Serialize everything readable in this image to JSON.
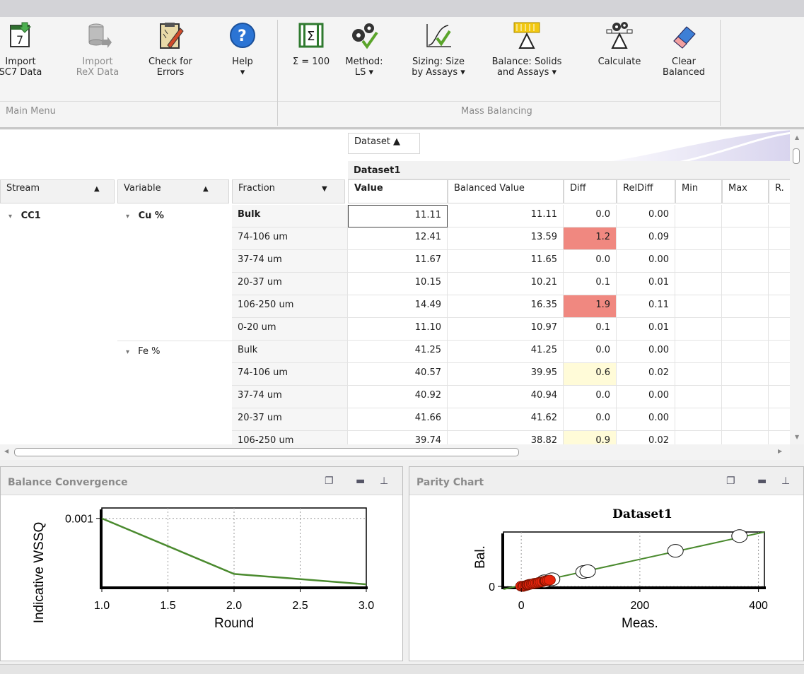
{
  "ribbon": {
    "buttons": [
      {
        "label": "Import\nSC7 Data"
      },
      {
        "label": "Import\nReX Data"
      },
      {
        "label": "Check for\nErrors"
      },
      {
        "label": "Help\n▾"
      },
      {
        "label": "Σ = 100"
      },
      {
        "label": "Method:\nLS ▾"
      },
      {
        "label": "Sizing: Size\nby Assays ▾"
      },
      {
        "label": "Balance: Solids\nand Assays ▾"
      },
      {
        "label": "Calculate"
      },
      {
        "label": "Clear\nBalanced"
      }
    ],
    "groups": {
      "main": "Main Menu",
      "mass": "Mass Balancing"
    }
  },
  "grid": {
    "group_by": "Dataset ▲",
    "dataset": "Dataset1",
    "row_headers": [
      "Stream",
      "Variable",
      "Fraction"
    ],
    "columns": [
      "Value",
      "Balanced Value",
      "Diff",
      "RelDiff",
      "Min",
      "Max",
      "R."
    ],
    "stream": "CC1",
    "variables": [
      "Cu %",
      "Fe %"
    ],
    "rows": [
      {
        "fraction": "Bulk",
        "value": "11.11",
        "balanced": "11.11",
        "diff": "0.0",
        "reldiff": "0.00"
      },
      {
        "fraction": "74-106 um",
        "value": "12.41",
        "balanced": "13.59",
        "diff": "1.2",
        "reldiff": "0.09"
      },
      {
        "fraction": "37-74 um",
        "value": "11.67",
        "balanced": "11.65",
        "diff": "0.0",
        "reldiff": "0.00"
      },
      {
        "fraction": "20-37 um",
        "value": "10.15",
        "balanced": "10.21",
        "diff": "0.1",
        "reldiff": "0.01"
      },
      {
        "fraction": "106-250 um",
        "value": "14.49",
        "balanced": "16.35",
        "diff": "1.9",
        "reldiff": "0.11"
      },
      {
        "fraction": "0-20 um",
        "value": "11.10",
        "balanced": "10.97",
        "diff": "0.1",
        "reldiff": "0.01"
      },
      {
        "fraction": "Bulk",
        "value": "41.25",
        "balanced": "41.25",
        "diff": "0.0",
        "reldiff": "0.00"
      },
      {
        "fraction": "74-106 um",
        "value": "40.57",
        "balanced": "39.95",
        "diff": "0.6",
        "reldiff": "0.02"
      },
      {
        "fraction": "37-74 um",
        "value": "40.92",
        "balanced": "40.94",
        "diff": "0.0",
        "reldiff": "0.00"
      },
      {
        "fraction": "20-37 um",
        "value": "41.66",
        "balanced": "41.62",
        "diff": "0.0",
        "reldiff": "0.00"
      },
      {
        "fraction": "106-250 um",
        "value": "39.74",
        "balanced": "38.82",
        "diff": "0.9",
        "reldiff": "0.02"
      }
    ]
  },
  "panes": {
    "convergence_title": "Balance Convergence",
    "parity_title": "Parity Chart"
  },
  "chart_data": [
    {
      "type": "line",
      "title": "",
      "xlabel": "Round",
      "ylabel": "Indicative WSSQ",
      "x": [
        1.0,
        2.0,
        3.0
      ],
      "series": [
        {
          "values": [
            0.001,
            0.0002,
            5e-05
          ]
        }
      ],
      "xlim": [
        1.0,
        3.0
      ],
      "ylim": [
        0,
        0.00115
      ],
      "xticks": [
        "1.0",
        "1.5",
        "2.0",
        "2.5",
        "3.0"
      ],
      "yticks": [
        "0.001"
      ],
      "grid": true,
      "color": "#4a8a2e"
    },
    {
      "type": "scatter",
      "title": "Dataset1",
      "xlabel": "Meas.",
      "ylabel": "Bal.",
      "xlim": [
        -30,
        410
      ],
      "ylim": [
        -10,
        400
      ],
      "xticks": [
        "0",
        "200",
        "400"
      ],
      "yticks": [
        "0"
      ],
      "grid": true,
      "line_color": "#4a8a2e",
      "red_points": [
        [
          0,
          2
        ],
        [
          3,
          0
        ],
        [
          5,
          4
        ],
        [
          8,
          6
        ],
        [
          10,
          10
        ],
        [
          11,
          11
        ],
        [
          12,
          13
        ],
        [
          14,
          16
        ],
        [
          15,
          15
        ],
        [
          18,
          18
        ],
        [
          20,
          19
        ],
        [
          22,
          23
        ],
        [
          25,
          24
        ],
        [
          28,
          27
        ],
        [
          30,
          30
        ],
        [
          33,
          32
        ],
        [
          36,
          35
        ],
        [
          40,
          40
        ],
        [
          41,
          41
        ],
        [
          42,
          42
        ],
        [
          45,
          44
        ],
        [
          48,
          47
        ]
      ],
      "white_points": [
        [
          39,
          38
        ],
        [
          52,
          53
        ],
        [
          105,
          106
        ],
        [
          112,
          112
        ],
        [
          260,
          262
        ],
        [
          368,
          370
        ]
      ],
      "red_color": "#e8240c"
    }
  ],
  "colors": {
    "diff_high": "#f08880",
    "diff_mid": "#fffbd8"
  }
}
